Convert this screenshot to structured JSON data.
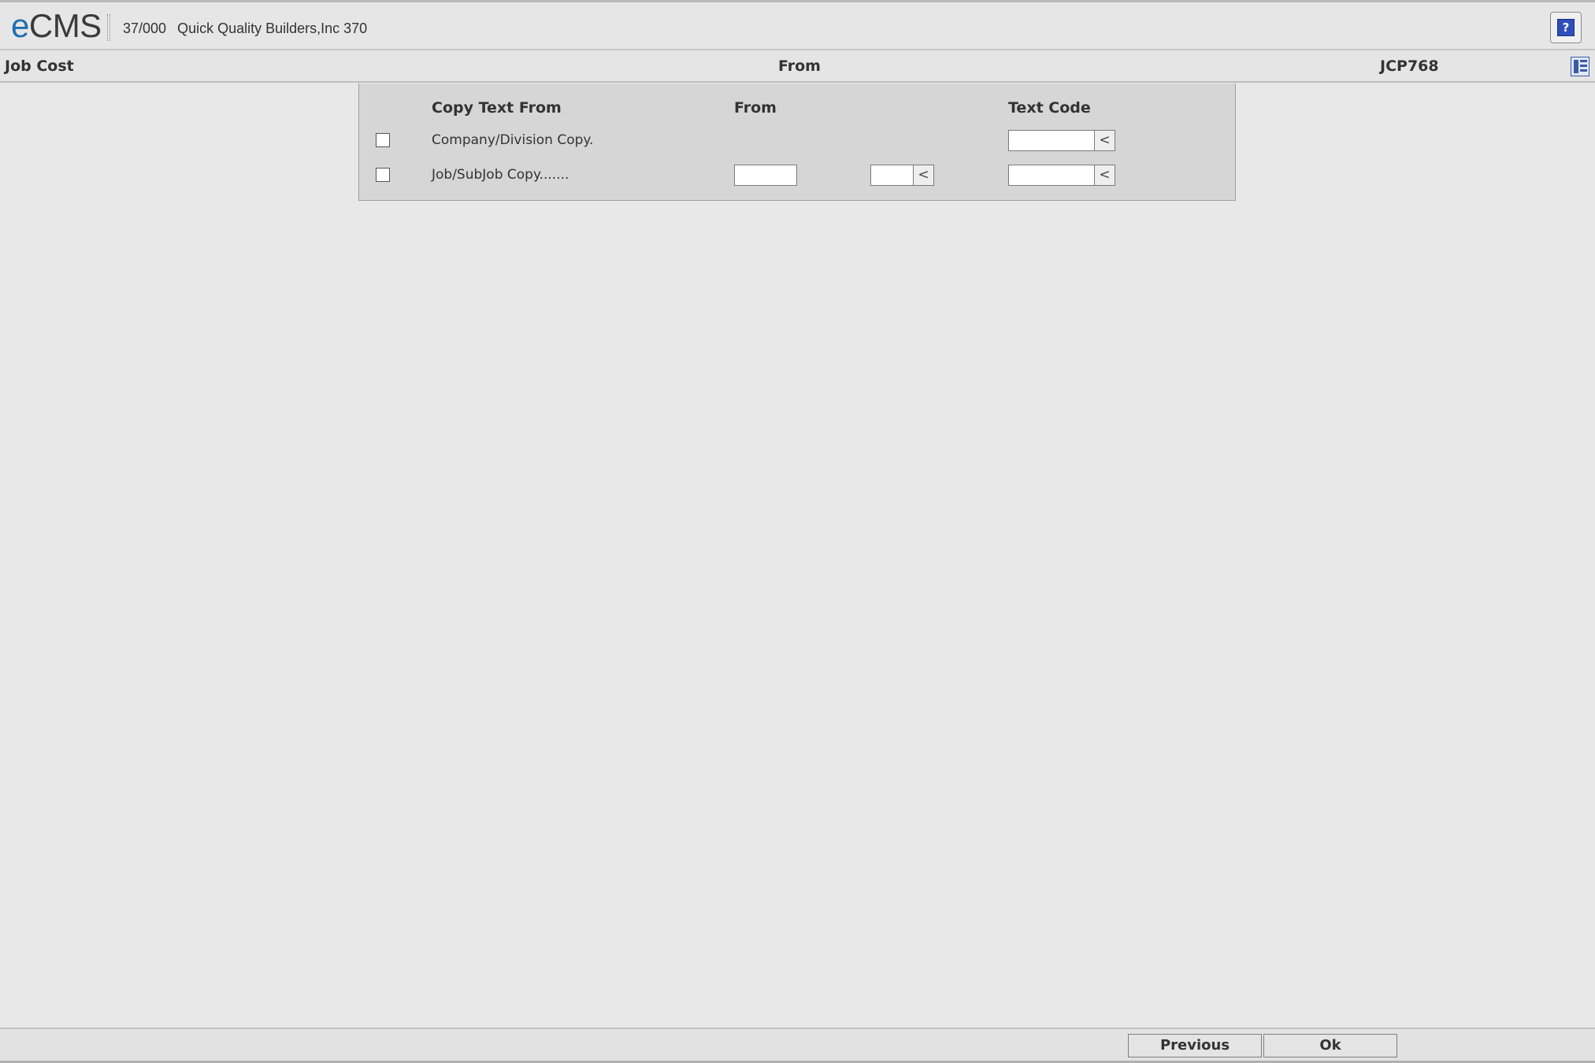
{
  "app": {
    "logo_e": "e",
    "logo_rest": "CMS",
    "company_code": "37/000",
    "company_name": "Quick Quality Builders,Inc 370",
    "help_label": "?"
  },
  "titlebar": {
    "left": "Job Cost",
    "middle": "From",
    "right": "JCP768"
  },
  "form": {
    "headers": {
      "copy_text_from": "Copy Text From",
      "from": "From",
      "text_code": "Text Code"
    },
    "rows": [
      {
        "label": "Company/Division Copy.",
        "checked": false,
        "text_code": ""
      },
      {
        "label": "Job/SubJob Copy.......",
        "checked": false,
        "job": "",
        "subjob": "",
        "text_code": ""
      }
    ],
    "lookup_glyph": "<"
  },
  "buttons": {
    "previous": "Previous",
    "ok": "Ok"
  }
}
